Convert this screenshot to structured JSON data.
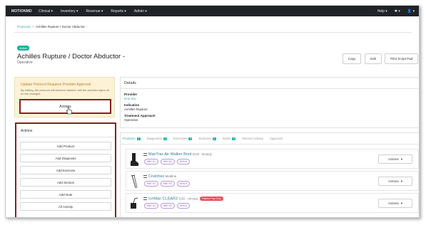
{
  "nav": {
    "logo": "MOTIONMD",
    "menu": [
      "Clinical ▾",
      "Inventory ▾",
      "Revenue ▾",
      "Reports ▾",
      "Admin ▾"
    ],
    "help": "Help ▾",
    "settings": "✱ ▾",
    "user": "👤 ▾"
  },
  "breadcrumb": {
    "root": "Protocols",
    "sep": "/",
    "current": "Achilles Rupture / Doctor Abductor -"
  },
  "header": {
    "status": "Active",
    "title": "Achilles Rupture / Doctor Abductor -",
    "subtitle": "Operative",
    "buttons": {
      "copy": "Copy",
      "edit": "Edit",
      "print": "Print Script Pad"
    }
  },
  "warning": {
    "title": "Update Protocol Requires Provider Approval",
    "text": "By editing, the protocol will become inactive until the provider signs off on the changes.",
    "actions_button": "Actions"
  },
  "actions_panel": {
    "title": "Actions",
    "buttons": [
      "Add Product",
      "Add Diagnosis",
      "Add Exercise",
      "Add Section",
      "Add Note",
      "All Activity"
    ]
  },
  "details": {
    "heading": "Details",
    "provider_label": "Provider",
    "provider_value": "Doe asy",
    "indication_label": "Indication",
    "indication_value": "Achilles Rupture",
    "treatment_label": "Treatment Approach",
    "treatment_value": "Operative"
  },
  "tabs": [
    {
      "label": "Products",
      "count": "3"
    },
    {
      "label": "Diagnoses",
      "count": "3"
    },
    {
      "label": "Exercises",
      "count": "0"
    },
    {
      "label": "Sections",
      "count": "0"
    },
    {
      "label": "Notes",
      "count": "0"
    },
    {
      "label": "Recent Activity",
      "count": ""
    },
    {
      "label": "Approval",
      "count": ""
    }
  ],
  "products": [
    {
      "name": "MaxTrax Air Walker Boot",
      "meta": "DJO - Donjoy",
      "codes": [
        "M67.01",
        "M67.02",
        "M76.6"
      ],
      "pill": "",
      "actions": "Actions"
    },
    {
      "name": "Crutches",
      "meta": "Medline",
      "codes": [
        "M67.01",
        "M67.02",
        "M76.6"
      ],
      "pill": "",
      "actions": "Actions"
    },
    {
      "name": "IceMan CLEAR3",
      "meta": "DJO - Aircast",
      "codes": [
        "M67.01",
        "M67.02",
        "M76.6"
      ],
      "pill": "Patient Pay Only",
      "actions": "Actions"
    }
  ],
  "colors": {
    "accent": "#20b09b",
    "highlight": "#8b1d1d",
    "warning_bg": "#fdf2d6",
    "chip": "#7e56b5",
    "pill": "#e84a55"
  }
}
